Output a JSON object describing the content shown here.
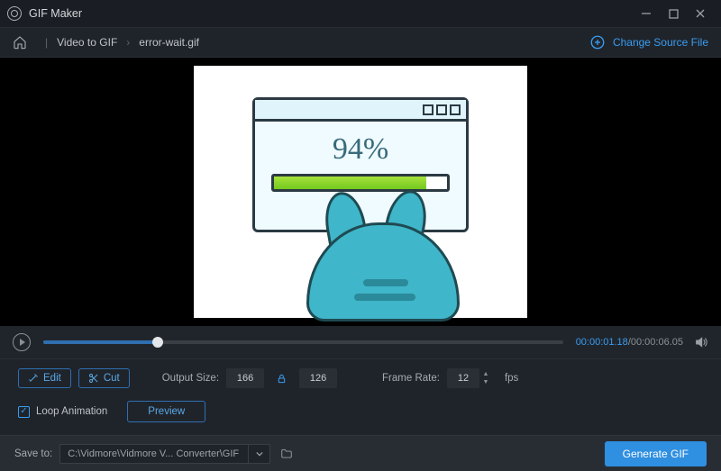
{
  "titlebar": {
    "app_name": "GIF Maker"
  },
  "breadcrumb": {
    "section": "Video to GIF",
    "file": "error-wait.gif",
    "change_label": "Change Source File"
  },
  "preview": {
    "progress_text": "94%"
  },
  "playback": {
    "current_time": "00:00:01.18",
    "total_time": "00:00:06.05"
  },
  "controls": {
    "edit_label": "Edit",
    "cut_label": "Cut",
    "output_size_label": "Output Size:",
    "width": "166",
    "height": "126",
    "frame_rate_label": "Frame Rate:",
    "frame_rate": "12",
    "fps_label": "fps",
    "loop_label": "Loop Animation",
    "preview_label": "Preview"
  },
  "bottom": {
    "save_to_label": "Save to:",
    "path": "C:\\Vidmore\\Vidmore V... Converter\\GIF Maker",
    "generate_label": "Generate GIF"
  }
}
